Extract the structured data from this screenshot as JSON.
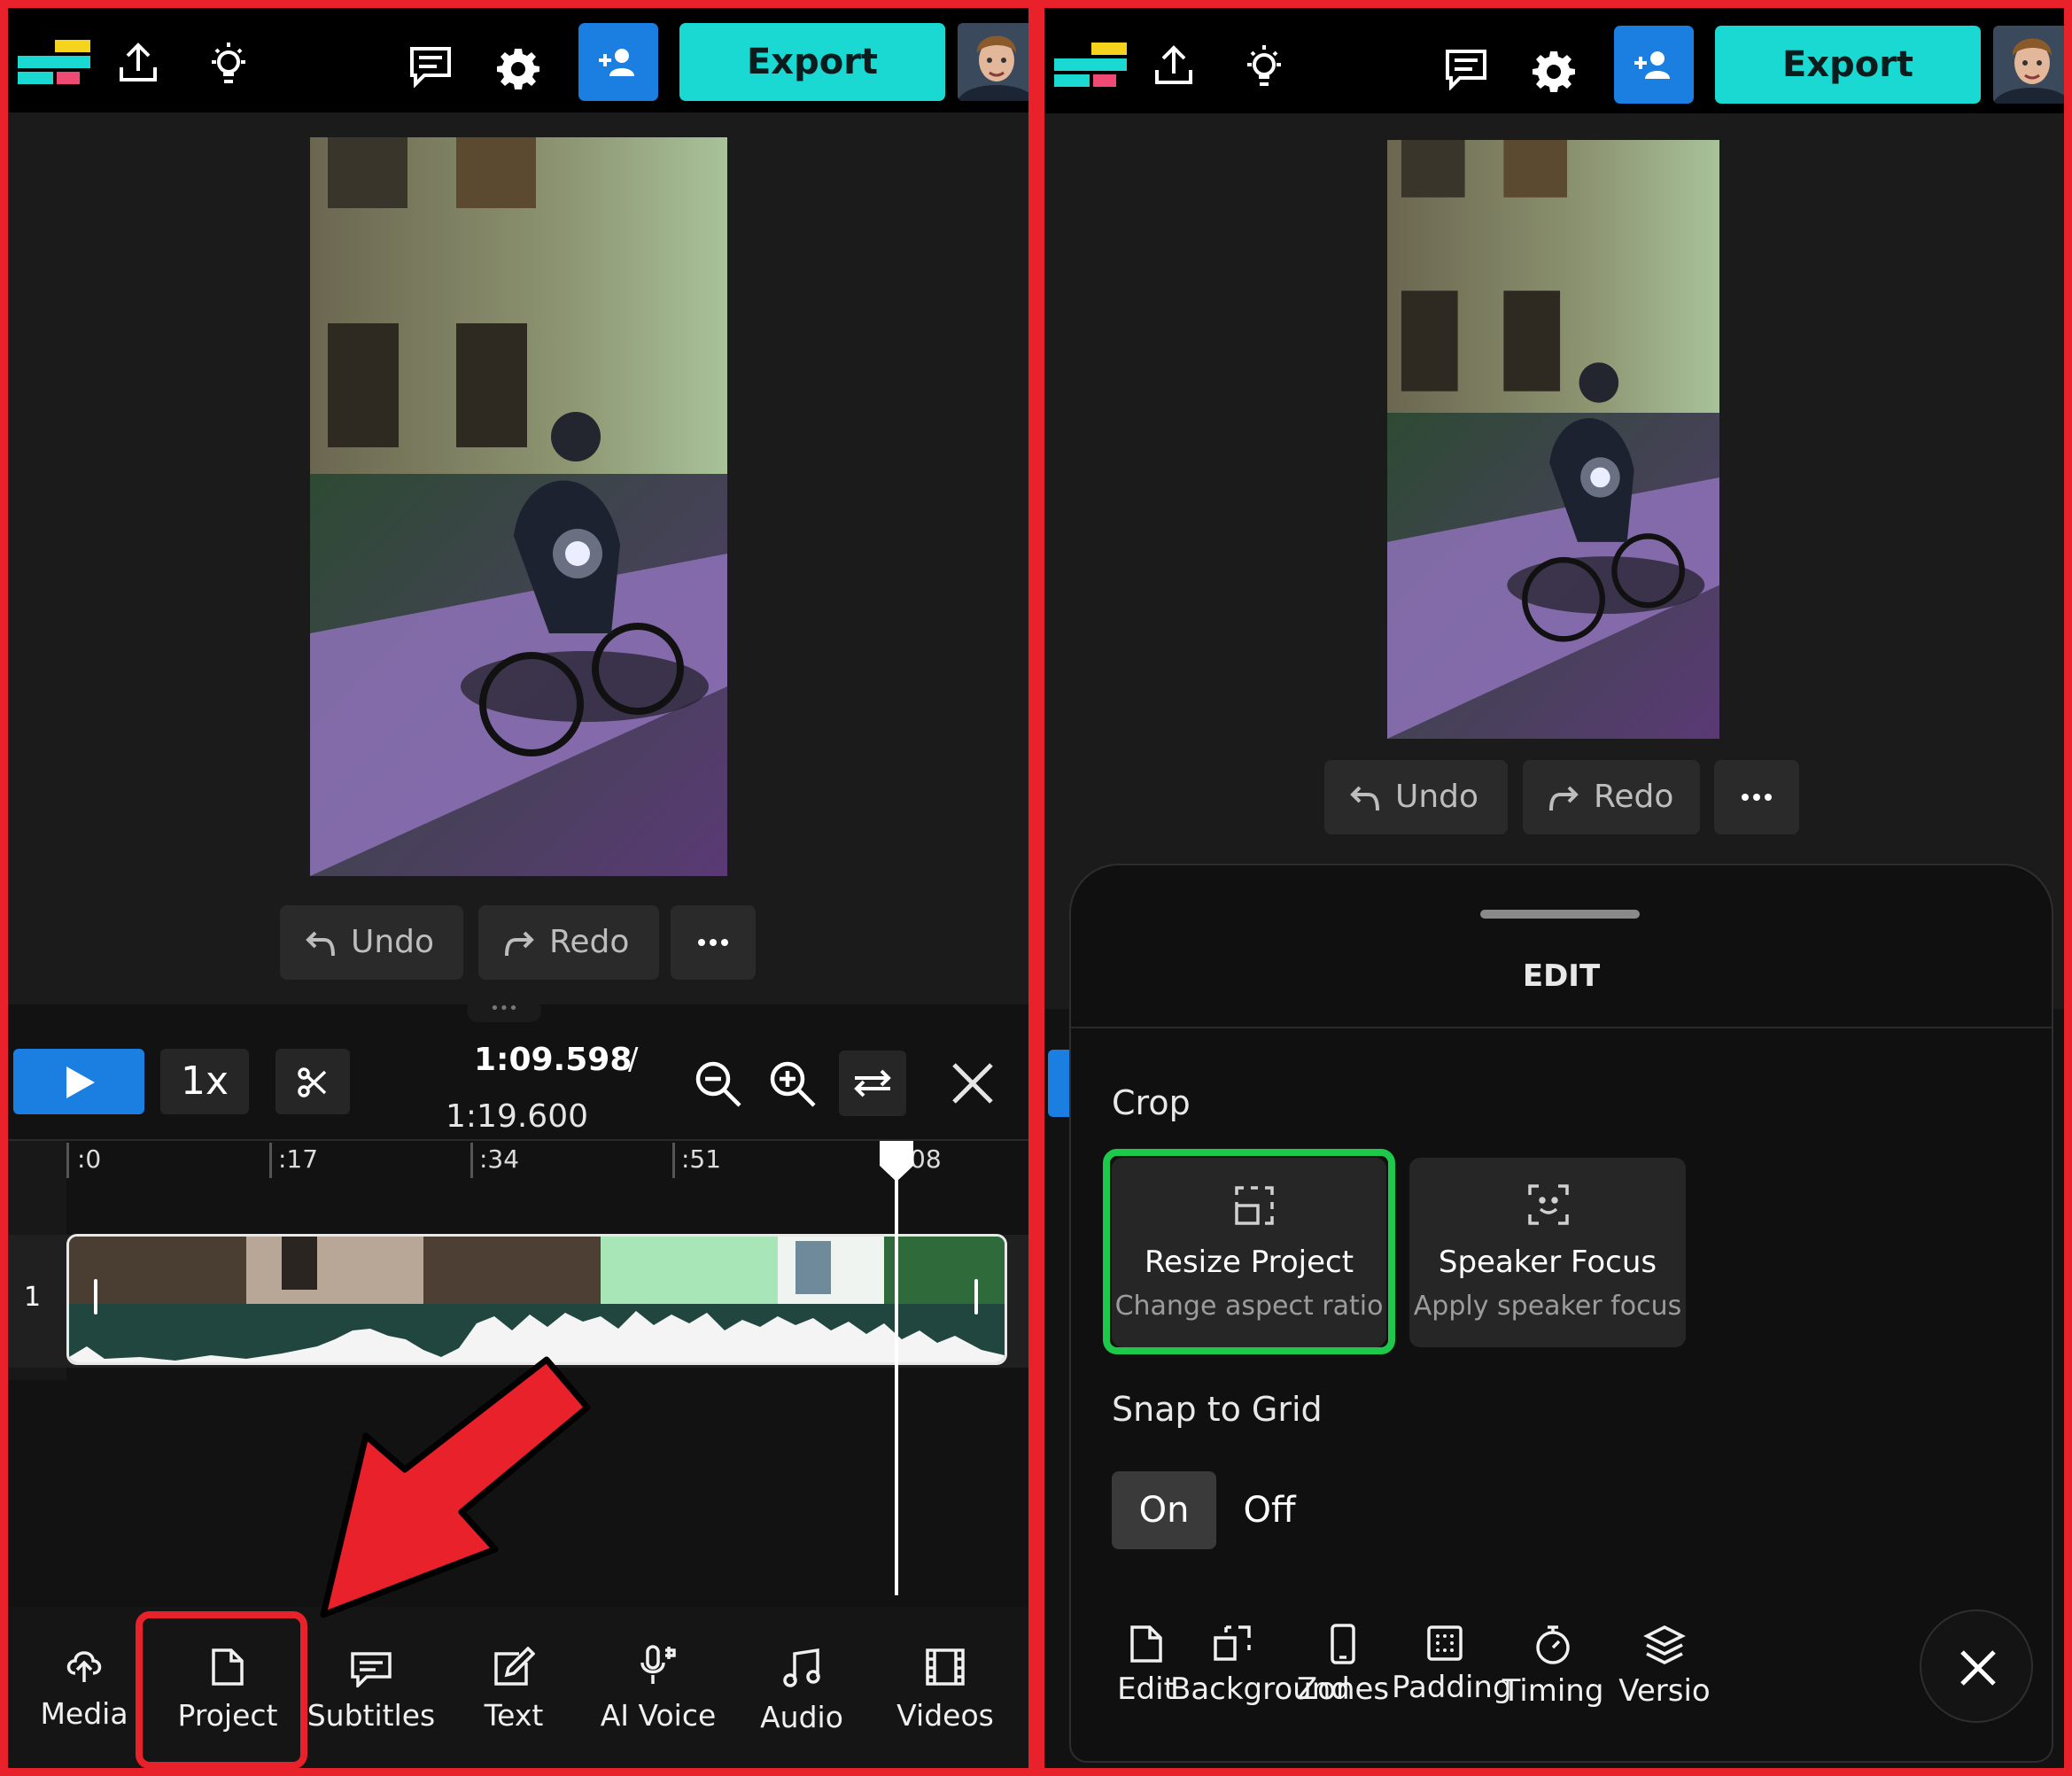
{
  "toolbar": {
    "export_label": "Export"
  },
  "edit_controls": {
    "undo_label": "Undo",
    "redo_label": "Redo"
  },
  "player": {
    "speed": "1x",
    "current_time": "1:09.598",
    "separator": "/",
    "total_time": "1:19.600"
  },
  "timeline": {
    "ruler": [
      ":0",
      ":17",
      ":34",
      ":51",
      "08"
    ],
    "track_number": "1"
  },
  "bottom_nav": [
    {
      "label": "Media",
      "icon": "upload-cloud-icon"
    },
    {
      "label": "Project",
      "icon": "document-icon"
    },
    {
      "label": "Subtitles",
      "icon": "subtitles-icon"
    },
    {
      "label": "Text",
      "icon": "edit-pencil-icon"
    },
    {
      "label": "AI Voice",
      "icon": "microphone-icon"
    },
    {
      "label": "Audio",
      "icon": "music-note-icon"
    },
    {
      "label": "Videos",
      "icon": "film-icon"
    }
  ],
  "edit_sheet": {
    "title": "EDIT",
    "crop_heading": "Crop",
    "cards": [
      {
        "title": "Resize Project",
        "subtitle": "Change aspect ratio",
        "icon": "resize-icon"
      },
      {
        "title": "Speaker Focus",
        "subtitle": "Apply speaker focus",
        "icon": "face-focus-icon"
      }
    ],
    "snap_heading": "Snap to Grid",
    "snap_on": "On",
    "snap_off": "Off",
    "tools": [
      {
        "label": "Edit",
        "icon": "document-icon"
      },
      {
        "label": "Background",
        "icon": "background-icon"
      },
      {
        "label": "Zones",
        "icon": "phone-icon"
      },
      {
        "label": "Padding",
        "icon": "padding-icon"
      },
      {
        "label": "Timing",
        "icon": "stopwatch-icon"
      },
      {
        "label": "Versio",
        "icon": "layers-icon"
      }
    ]
  },
  "colors": {
    "accent": "#1ad9d3",
    "primary_blue": "#1a7fe0",
    "highlight_red": "#e8212a",
    "highlight_green": "#1ec84b"
  }
}
